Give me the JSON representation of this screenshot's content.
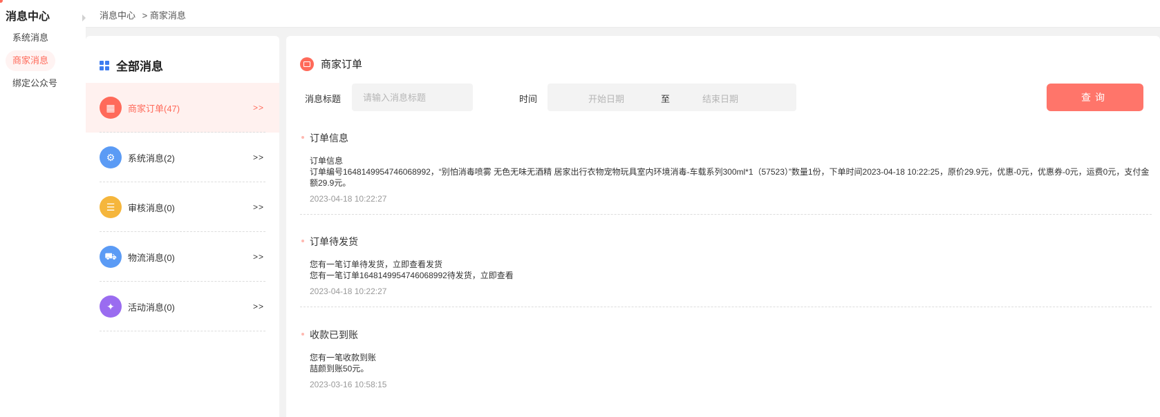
{
  "app": {
    "title": "消息中心",
    "nav": [
      {
        "label": "系统消息",
        "active": false
      },
      {
        "label": "商家消息",
        "active": true
      },
      {
        "label": "绑定公众号",
        "active": false
      }
    ]
  },
  "breadcrumb": [
    "消息中心",
    "> 商家消息"
  ],
  "categories": {
    "header": "全部消息",
    "items": [
      {
        "label": "商家订单(47)",
        "arrow": ">>",
        "icon": "shop-icon",
        "color": "#ff6a5a",
        "active": true
      },
      {
        "label": "系统消息(2)",
        "arrow": ">>",
        "icon": "monitor-gear-icon",
        "color": "#4a90f5",
        "active": false
      },
      {
        "label": "审核消息(0)",
        "arrow": ">>",
        "icon": "document-icon",
        "color": "#f5b63c",
        "active": false
      },
      {
        "label": "物流消息(0)",
        "arrow": ">>",
        "icon": "truck-icon",
        "color": "#4a90f5",
        "active": false
      },
      {
        "label": "活动消息(0)",
        "arrow": ">>",
        "icon": "gift-icon",
        "color": "#9a6cf0",
        "active": false
      }
    ]
  },
  "main": {
    "section_title": "商家订单",
    "filter": {
      "title_label": "消息标题",
      "title_placeholder": "请输入消息标题",
      "time_label": "时间",
      "start_placeholder": "开始日期",
      "to": "至",
      "end_placeholder": "结束日期",
      "query_button": "查询"
    },
    "messages": [
      {
        "title": "订单信息",
        "lines": [
          "订单信息",
          "订单编号1648149954746068992，“别怕消毒喷雾 无色无味无酒精 居家出行衣物宠物玩具室内环境消毒-车载系列300ml*1（57523）”数量1份，下单时间2023-04-18 10:22:25，原价29.9元，优惠-0元，优惠券-0元，运费0元，支付金额29.9元。"
        ],
        "time": "2023-04-18 10:22:27"
      },
      {
        "title": "订单待发货",
        "lines": [
          "您有一笔订单待发货，立即查看发货",
          "您有一笔订单1648149954746068992待发货，立即查看"
        ],
        "time": "2023-04-18 10:22:27"
      },
      {
        "title": "收款已到账",
        "lines": [
          "您有一笔收款到账",
          "喆颜到账50元。"
        ],
        "time": "2023-03-16 10:58:15"
      }
    ]
  },
  "colors": {
    "accent": "#ff6a5a",
    "button": "#ff756a"
  }
}
